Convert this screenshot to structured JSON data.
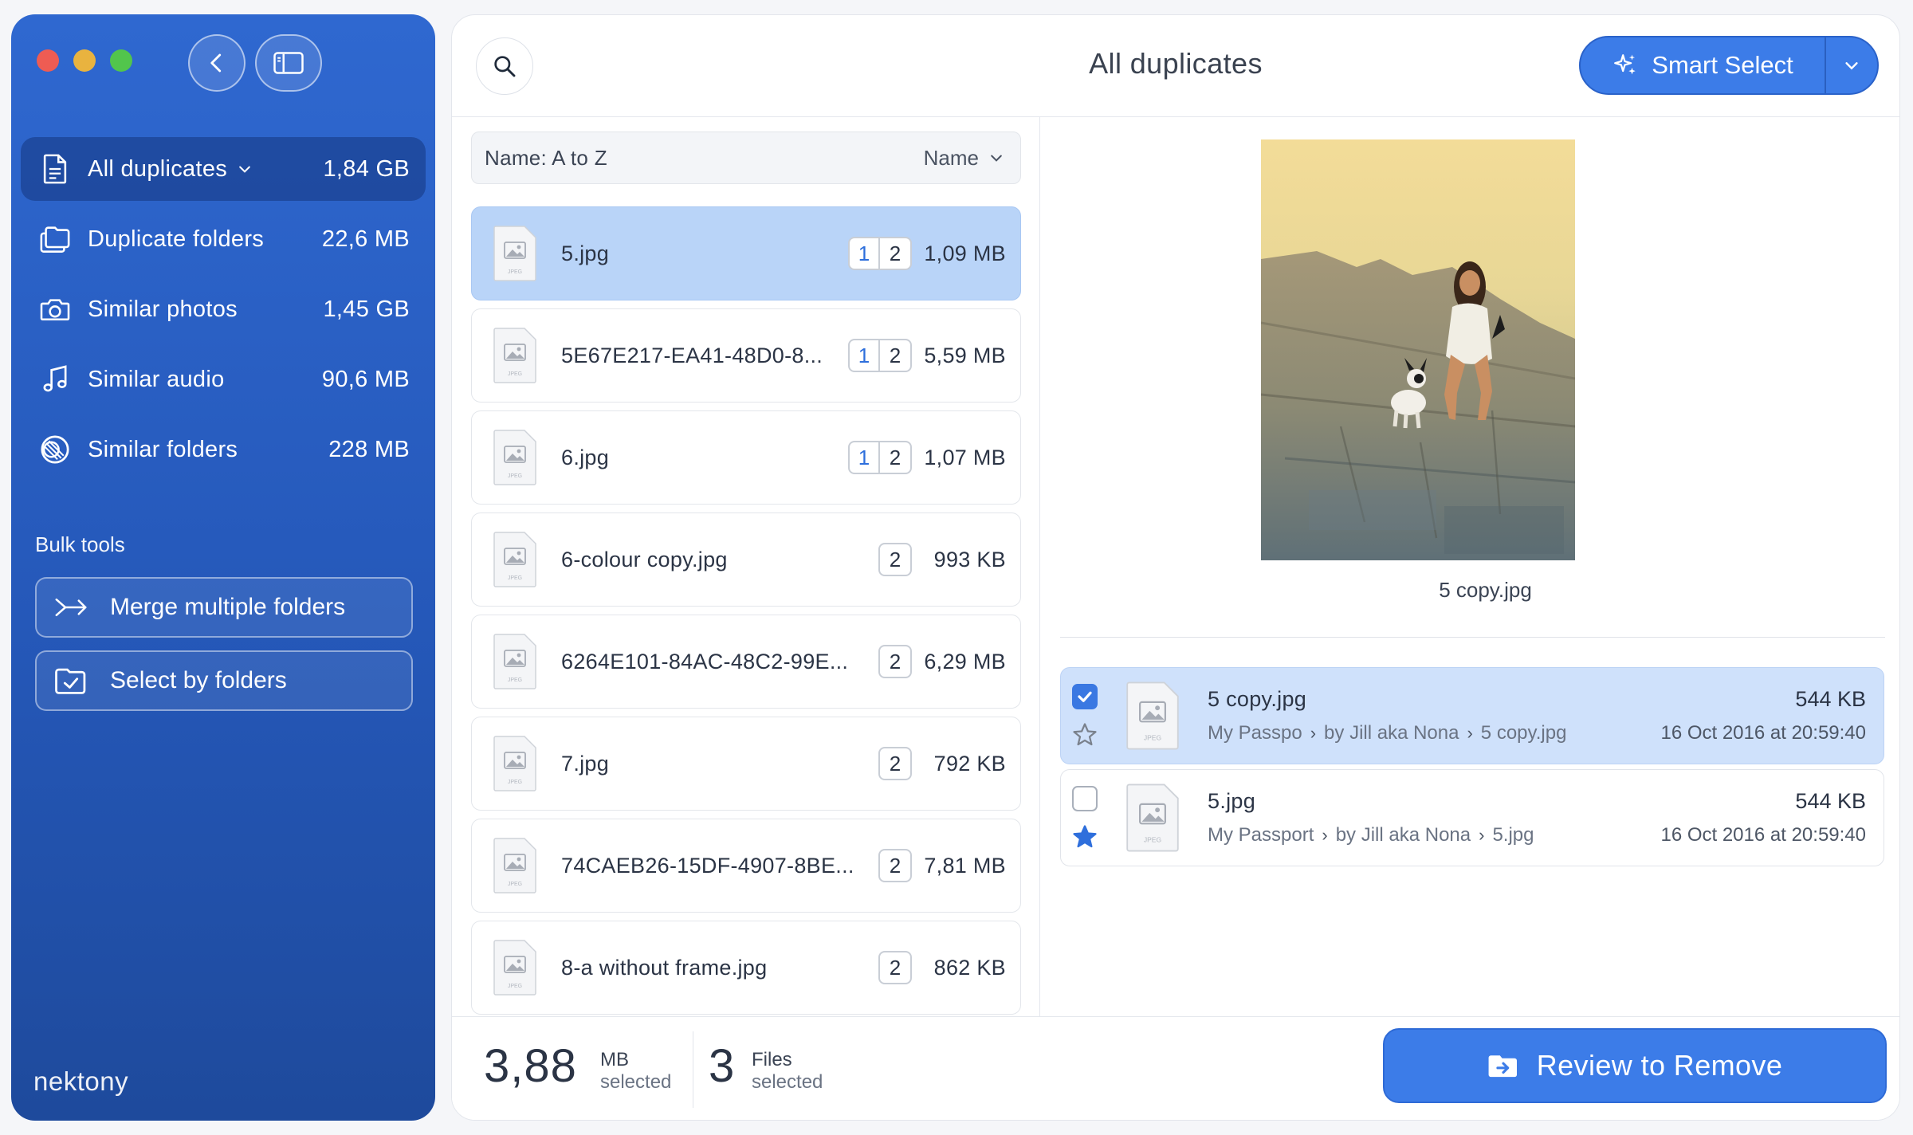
{
  "window": {
    "title": "All duplicates"
  },
  "sidebar": {
    "items": [
      {
        "label": "All duplicates",
        "size": "1,84 GB",
        "icon": "document-icon"
      },
      {
        "label": "Duplicate folders",
        "size": "22,6 MB",
        "icon": "folders-icon"
      },
      {
        "label": "Similar photos",
        "size": "1,45 GB",
        "icon": "camera-icon"
      },
      {
        "label": "Similar audio",
        "size": "90,6 MB",
        "icon": "music-note-icon"
      },
      {
        "label": "Similar folders",
        "size": "228 MB",
        "icon": "similar-circles-icon"
      }
    ],
    "bulk_title": "Bulk tools",
    "bulk_tools": [
      {
        "label": "Merge multiple folders",
        "icon": "merge-arrows-icon"
      },
      {
        "label": "Select by folders",
        "icon": "folder-check-icon"
      }
    ],
    "brand": "nektony"
  },
  "toolbar": {
    "smart_select": "Smart Select"
  },
  "sort": {
    "label": "Name: A to Z",
    "key": "Name"
  },
  "files": [
    {
      "name": "5.jpg",
      "badge1": "1",
      "badge2": "2",
      "size": "1,09 MB",
      "selected": true
    },
    {
      "name": "5E67E217-EA41-48D0-8...",
      "badge1": "1",
      "badge2": "2",
      "size": "5,59 MB"
    },
    {
      "name": "6.jpg",
      "badge1": "1",
      "badge2": "2",
      "size": "1,07 MB"
    },
    {
      "name": "6-colour copy.jpg",
      "badge2": "2",
      "size": "993 KB"
    },
    {
      "name": "6264E101-84AC-48C2-99E...",
      "badge2": "2",
      "size": "6,29 MB"
    },
    {
      "name": "7.jpg",
      "badge2": "2",
      "size": "792 KB"
    },
    {
      "name": "74CAEB26-15DF-4907-8BE...",
      "badge2": "2",
      "size": "7,81 MB"
    },
    {
      "name": "8-a without frame.jpg",
      "badge2": "2",
      "size": "862 KB"
    }
  ],
  "preview": {
    "caption": "5 copy.jpg",
    "copies": [
      {
        "name": "5 copy.jpg",
        "path": [
          "My Passpo",
          "by Jill aka Nona",
          "5 copy.jpg"
        ],
        "size": "544 KB",
        "date": "16 Oct 2016 at 20:59:40",
        "checked": true,
        "starred": false
      },
      {
        "name": "5.jpg",
        "path": [
          "My Passport",
          "by Jill aka Nona",
          "5.jpg"
        ],
        "size": "544 KB",
        "date": "16 Oct 2016 at 20:59:40",
        "checked": false,
        "starred": true
      }
    ]
  },
  "footer": {
    "size_value": "3,88",
    "size_unit": "MB",
    "size_sub": "selected",
    "files_value": "3",
    "files_unit": "Files",
    "files_sub": "selected",
    "review_label": "Review to Remove"
  },
  "colors": {
    "accent": "#3c7ce8",
    "sidebar": "#2f68d0",
    "selected_row": "#b9d4f8"
  }
}
